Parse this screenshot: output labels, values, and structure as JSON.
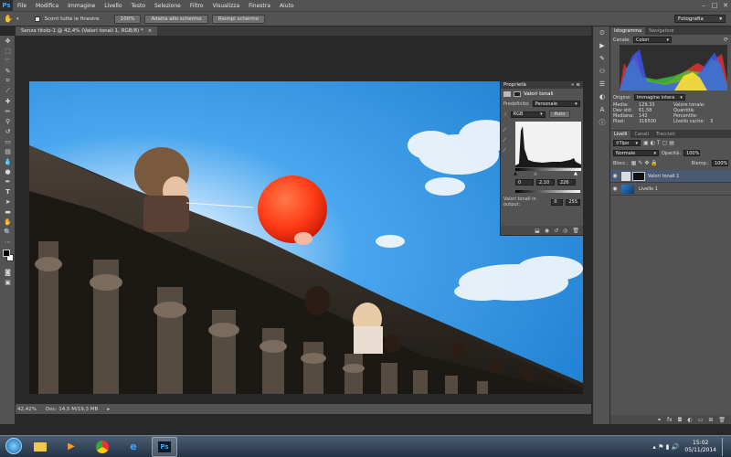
{
  "app": {
    "name": "Ps",
    "menu": [
      "File",
      "Modifica",
      "Immagine",
      "Livello",
      "Testo",
      "Selezione",
      "Filtro",
      "Visualizza",
      "Finestra",
      "Aiuto"
    ],
    "workspace": "Fotografia"
  },
  "options": {
    "scroll_all_label": "Scorri tutte le finestre",
    "zoom_100_label": "100%",
    "fit_screen_label": "Adatta allo schermo",
    "fill_screen_label": "Riempi schermo"
  },
  "document": {
    "tab_title": "Senza titolo-1 @ 42,4% (Valori tonali 1, RGB/8) *",
    "zoom": "42,42%",
    "doc_size": "Doc: 14,5 M/19,3 MB"
  },
  "properties": {
    "title": "Proprietà",
    "adjustment": "Valori tonali",
    "preset_label": "Predefinito:",
    "preset_value": "Personale",
    "channel": "RGB",
    "auto_label": "Auto",
    "input_black": "0",
    "input_gamma": "2,10",
    "input_white": "226",
    "output_label": "Valori tonali in output:",
    "output_black": "0",
    "output_white": "255"
  },
  "histogram": {
    "tabs": [
      "Istogramma",
      "Navigatore"
    ],
    "channel_label": "Canale:",
    "channel_value": "Colori",
    "source_label": "Origine:",
    "source_value": "Immagine intera",
    "stats_left": [
      {
        "k": "Media:",
        "v": "129,33"
      },
      {
        "k": "Dev std:",
        "v": "61,58"
      },
      {
        "k": "Mediana:",
        "v": "142"
      },
      {
        "k": "Pixel:",
        "v": "316500"
      }
    ],
    "stats_right": [
      {
        "k": "Valore tonale:",
        "v": ""
      },
      {
        "k": "Quantità:",
        "v": ""
      },
      {
        "k": "Percentile:",
        "v": ""
      },
      {
        "k": "Livello cache:",
        "v": "3"
      }
    ]
  },
  "layers_panel": {
    "tabs": [
      "Livelli",
      "Canali",
      "Tracciati"
    ],
    "kind_label": "Tipo",
    "blend_mode": "Normale",
    "opacity_label": "Opacità:",
    "opacity_value": "100%",
    "lock_label": "Blocc.:",
    "fill_label": "Riemp.:",
    "fill_value": "100%",
    "layers": [
      {
        "name": "Valori tonali 1",
        "selected": true
      },
      {
        "name": "Livello 1",
        "selected": false
      }
    ]
  },
  "taskbar": {
    "time": "15:02",
    "date": "05/11/2014"
  },
  "colors": {
    "panel_bg": "#535353",
    "canvas_bg": "#282828",
    "accent": "#31a8ff",
    "balloon": "#ff3b1f",
    "sky": "#1f8ae0"
  }
}
